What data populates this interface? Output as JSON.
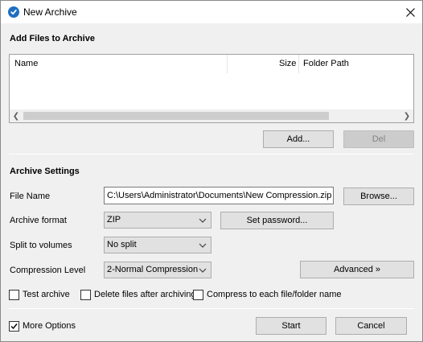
{
  "window": {
    "title": "New Archive"
  },
  "add_files": {
    "section_title": "Add Files to Archive",
    "columns": [
      "Name",
      "Size",
      "Folder Path"
    ],
    "add_label": "Add...",
    "del_label": "Del"
  },
  "settings": {
    "section_title": "Archive Settings",
    "file_name_label": "File Name",
    "file_name_value": "C:\\Users\\Administrator\\Documents\\New Compression.zip",
    "browse_label": "Browse...",
    "format_label": "Archive format",
    "format_value": "ZIP",
    "password_label": "Set password...",
    "split_label": "Split to volumes",
    "split_value": "No split",
    "compression_label": "Compression Level",
    "compression_value": "2-Normal Compression",
    "advanced_label": "Advanced »"
  },
  "options": {
    "test_archive": {
      "label": "Test archive",
      "checked": false
    },
    "delete_after": {
      "label": "Delete files after archiving",
      "checked": false
    },
    "compress_each": {
      "label": "Compress to each file/folder name",
      "checked": false
    }
  },
  "footer": {
    "more_options": {
      "label": "More Options",
      "checked": true
    },
    "start_label": "Start",
    "cancel_label": "Cancel"
  },
  "colors": {
    "app_icon": "#1e6fc2"
  }
}
